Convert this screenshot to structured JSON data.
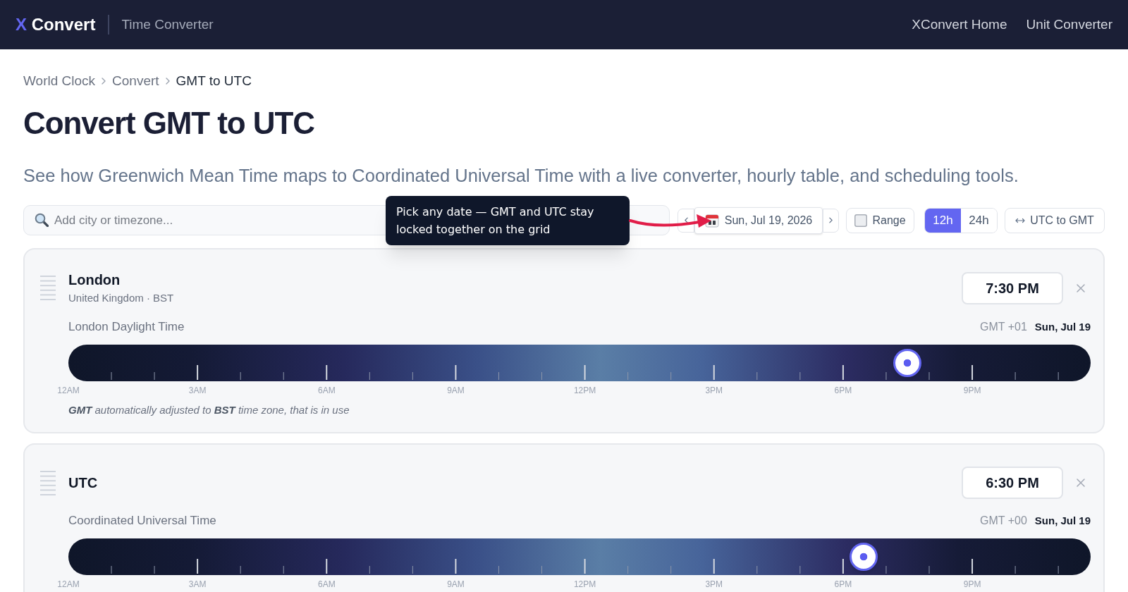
{
  "header": {
    "logo_mark": "X",
    "logo_text": "Convert",
    "section": "Time Converter",
    "links": [
      "XConvert Home",
      "Unit Converter"
    ]
  },
  "breadcrumb": [
    {
      "label": "World Clock",
      "current": false
    },
    {
      "label": "Convert",
      "current": false
    },
    {
      "label": "GMT to UTC",
      "current": true
    }
  ],
  "title": "Convert GMT to UTC",
  "subtitle": "See how Greenwich Mean Time maps to Coordinated Universal Time with a live converter, hourly table, and scheduling tools.",
  "toolbar": {
    "search": {
      "placeholder": "Add city or timezone..."
    },
    "date": "Sun, Jul 19, 2026",
    "range": "Range",
    "formats": [
      {
        "label": "12h",
        "selected": true
      },
      {
        "label": "24h",
        "selected": false
      }
    ],
    "swap": "UTC to GMT"
  },
  "tooltip": {
    "text": "Pick any date — GMT and UTC stay locked together on the grid"
  },
  "clocks": [
    {
      "city": "London",
      "region": "United Kingdom · BST",
      "time": "7:30 PM",
      "zone_name": "London Daylight Time",
      "offset": "GMT +01",
      "date": "Sun, Jul 19",
      "level": 0.821,
      "hour_labels": [
        "12AM",
        "3AM",
        "6AM",
        "9AM",
        "12PM",
        "3PM",
        "6PM",
        "9PM"
      ],
      "note": "**GMT** automatically adjusted to **BST** time zone, that is in use"
    },
    {
      "city": "UTC",
      "time": "6:30 PM",
      "zone_name": "Coordinated Universal Time",
      "offset": "GMT +00",
      "date": "Sun, Jul 19",
      "level": 0.778,
      "hour_labels": [
        "12AM",
        "3AM",
        "6AM",
        "9AM",
        "12PM",
        "3PM",
        "6PM",
        "9PM"
      ]
    }
  ]
}
